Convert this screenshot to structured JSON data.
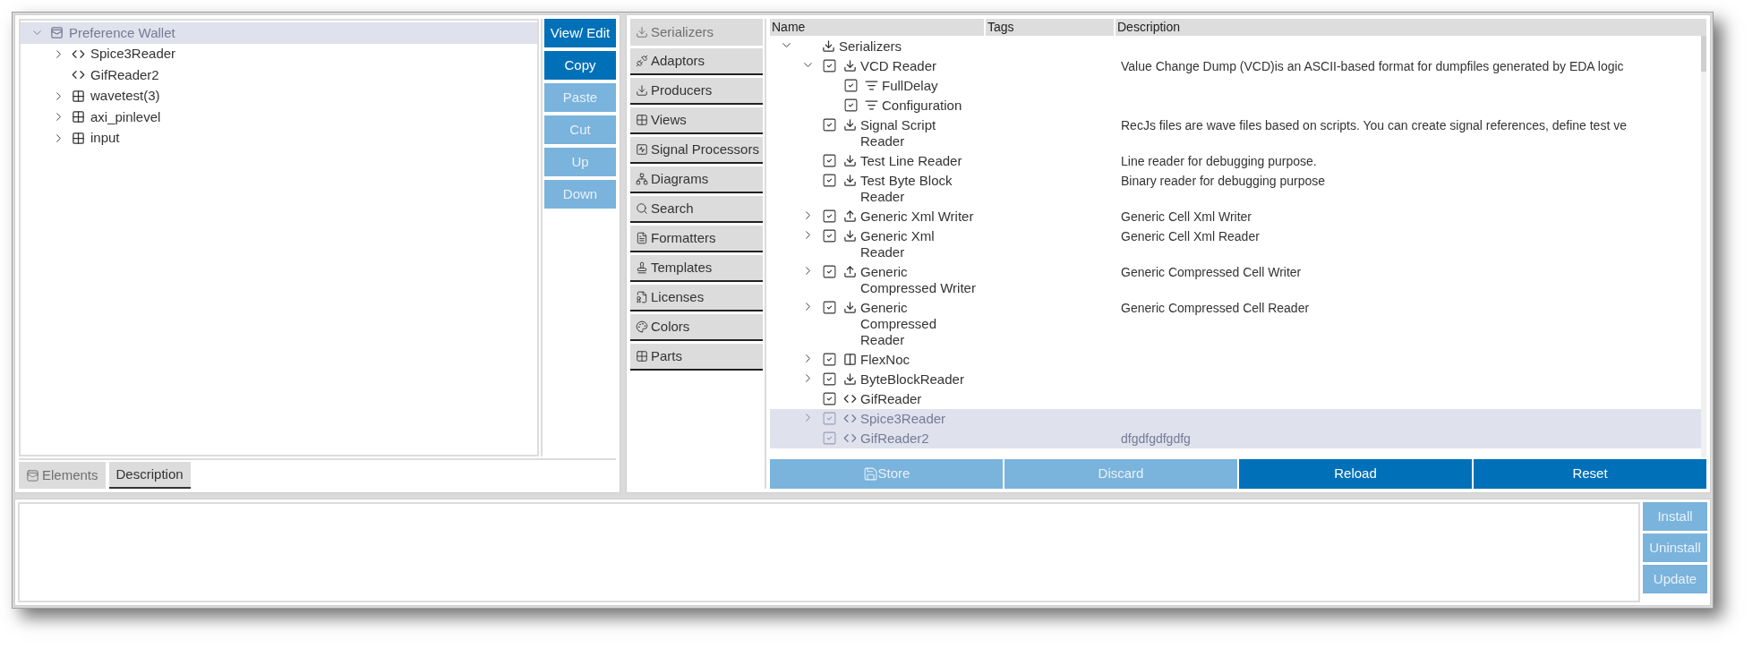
{
  "left_panel": {
    "tree": [
      {
        "label": "Preference Wallet",
        "kind": "wallet",
        "expanded": true,
        "selected": true,
        "children": [
          {
            "label": "Spice3Reader",
            "kind": "script",
            "expanded": false,
            "selected": false
          },
          {
            "label": "GifReader2",
            "kind": "script",
            "selected": false
          },
          {
            "label": "wavetest(3)",
            "kind": "view",
            "expanded": false,
            "selected": false
          },
          {
            "label": "axi_pinlevel",
            "kind": "view",
            "expanded": false,
            "selected": false
          },
          {
            "label": "input",
            "kind": "view",
            "expanded": false,
            "selected": false
          }
        ]
      }
    ],
    "buttons": [
      {
        "label": "View/ Edit",
        "disabled": false
      },
      {
        "label": "Copy",
        "disabled": false
      },
      {
        "label": "Paste",
        "disabled": true
      },
      {
        "label": "Cut",
        "disabled": true
      },
      {
        "label": "Up",
        "disabled": true
      },
      {
        "label": "Down",
        "disabled": true
      }
    ],
    "tabs": [
      {
        "label": "Elements",
        "kind": "wallet",
        "selected": true
      },
      {
        "label": "Description",
        "kind": "plain",
        "selected": false
      }
    ]
  },
  "category_tabs": [
    {
      "label": "Serializers",
      "selected": true
    },
    {
      "label": "Adaptors",
      "selected": false
    },
    {
      "label": "Producers",
      "selected": false
    },
    {
      "label": "Views",
      "selected": false
    },
    {
      "label": "Signal Processors",
      "selected": false
    },
    {
      "label": "Diagrams",
      "selected": false
    },
    {
      "label": "Search",
      "selected": false
    },
    {
      "label": "Formatters",
      "selected": false
    },
    {
      "label": "Templates",
      "selected": false
    },
    {
      "label": "Licenses",
      "selected": false
    },
    {
      "label": "Colors",
      "selected": false
    },
    {
      "label": "Parts",
      "selected": false
    }
  ],
  "table": {
    "columns": [
      "Name",
      "Tags",
      "Description"
    ],
    "tree": [
      {
        "label": "Serializers",
        "kind": "reader",
        "expanded": true,
        "selected": false,
        "children": [
          {
            "label": "VCD Reader",
            "kind": "reader",
            "expanded": true,
            "checked": true,
            "selected": false,
            "description": "Value Change Dump (VCD)is an ASCII-based format for dumpfiles generated by EDA logic",
            "children": [
              {
                "label": "FullDelay",
                "kind": "setting",
                "checked": true,
                "selected": false
              },
              {
                "label": "Configuration",
                "kind": "setting",
                "checked": true,
                "selected": false
              }
            ]
          },
          {
            "label": "Signal Script Reader",
            "kind": "reader",
            "checked": true,
            "selected": false,
            "description": "RecJs files are wave files based on scripts. You can create signal references, define test ve"
          },
          {
            "label": "Test Line Reader",
            "kind": "reader",
            "checked": true,
            "selected": false,
            "description": "Line reader for debugging purpose."
          },
          {
            "label": "Test Byte Block Reader",
            "kind": "reader",
            "checked": true,
            "selected": false,
            "description": "Binary reader for debugging purpose"
          },
          {
            "label": "Generic Xml Writer",
            "kind": "writer",
            "expanded": false,
            "checked": true,
            "selected": false,
            "description": "Generic Cell Xml Writer"
          },
          {
            "label": "Generic Xml Reader",
            "kind": "reader",
            "expanded": false,
            "checked": true,
            "selected": false,
            "description": "Generic Cell Xml Reader"
          },
          {
            "label": "Generic Compressed Writer",
            "kind": "writer",
            "expanded": false,
            "checked": true,
            "selected": false,
            "description": "Generic Compressed Cell Writer"
          },
          {
            "label": "Generic Compressed Reader",
            "kind": "reader",
            "expanded": false,
            "checked": true,
            "selected": false,
            "description": "Generic Compressed Cell Reader"
          },
          {
            "label": "FlexNoc",
            "kind": "panel",
            "expanded": false,
            "checked": true,
            "selected": false
          },
          {
            "label": "ByteBlockReader",
            "kind": "reader",
            "expanded": false,
            "checked": true,
            "selected": false
          },
          {
            "label": "GifReader",
            "kind": "script",
            "checked": true,
            "selected": false
          },
          {
            "label": "Spice3Reader",
            "kind": "script",
            "expanded": false,
            "checked": true,
            "selected": true
          },
          {
            "label": "GifReader2",
            "kind": "script",
            "checked": true,
            "selected": true,
            "description": "dfgdfgdfgdfg"
          }
        ]
      }
    ],
    "buttons": [
      {
        "label": "Store",
        "kind": "save",
        "disabled": true
      },
      {
        "label": "Discard",
        "kind": "plain",
        "disabled": true
      },
      {
        "label": "Reload",
        "kind": "plain",
        "disabled": false
      },
      {
        "label": "Reset",
        "kind": "plain",
        "disabled": false
      }
    ]
  },
  "bottom_panel": {
    "buttons": [
      {
        "label": "Install",
        "disabled": true
      },
      {
        "label": "Uninstall",
        "disabled": true
      },
      {
        "label": "Update",
        "disabled": true
      }
    ]
  }
}
